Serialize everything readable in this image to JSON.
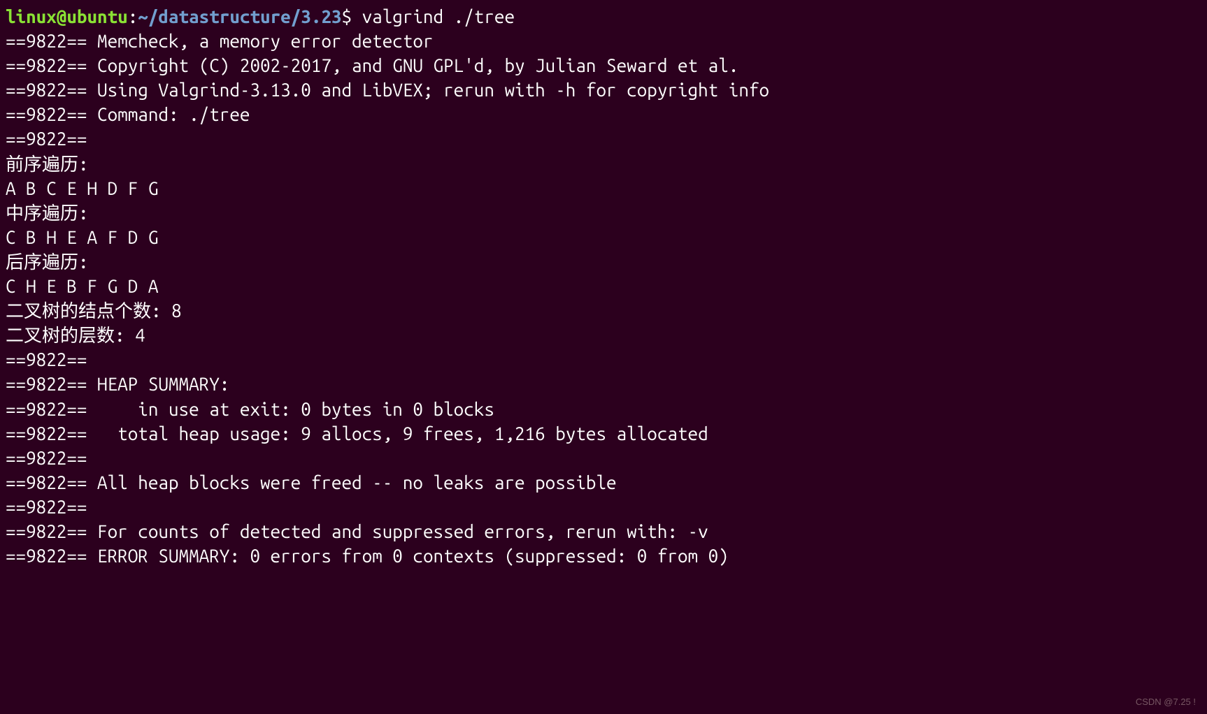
{
  "prompt": {
    "user": "linux@ubuntu",
    "colon": ":",
    "path": "~/datastructure/3.23",
    "dollar": "$ ",
    "command": "valgrind ./tree"
  },
  "lines": [
    "==9822== Memcheck, a memory error detector",
    "==9822== Copyright (C) 2002-2017, and GNU GPL'd, by Julian Seward et al.",
    "==9822== Using Valgrind-3.13.0 and LibVEX; rerun with -h for copyright info",
    "==9822== Command: ./tree",
    "==9822== ",
    "前序遍历:",
    "A B C E H D F G ",
    "中序遍历:",
    "C B H E A F D G ",
    "后序遍历:",
    "C H E B F G D A ",
    "二叉树的结点个数: 8",
    "二叉树的层数: 4",
    "==9822== ",
    "==9822== HEAP SUMMARY:",
    "==9822==     in use at exit: 0 bytes in 0 blocks",
    "==9822==   total heap usage: 9 allocs, 9 frees, 1,216 bytes allocated",
    "==9822== ",
    "==9822== All heap blocks were freed -- no leaks are possible",
    "==9822== ",
    "==9822== For counts of detected and suppressed errors, rerun with: -v",
    "==9822== ERROR SUMMARY: 0 errors from 0 contexts (suppressed: 0 from 0)"
  ],
  "watermark": "CSDN @7.25 !"
}
